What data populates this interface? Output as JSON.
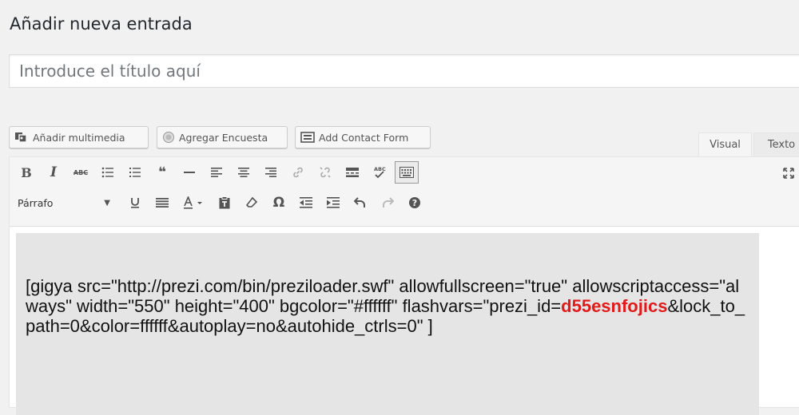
{
  "page": {
    "title": "Añadir nueva entrada"
  },
  "title_field": {
    "placeholder": "Introduce el título aquí",
    "value": ""
  },
  "media_buttons": [
    {
      "label": "Añadir multimedia",
      "icon": "media-icon"
    },
    {
      "label": "Agregar Encuesta",
      "icon": "poll-icon"
    },
    {
      "label": "Add Contact Form",
      "icon": "contact-form-icon"
    }
  ],
  "tabs": {
    "visual": "Visual",
    "text": "Texto",
    "active": "visual"
  },
  "toolbar": {
    "row1_icons": [
      "bold-icon",
      "italic-icon",
      "strikethrough-icon",
      "bullet-list-icon",
      "numbered-list-icon",
      "blockquote-icon",
      "horizontal-rule-icon",
      "align-left-icon",
      "align-center-icon",
      "align-right-icon",
      "link-icon",
      "unlink-icon",
      "read-more-icon",
      "spellcheck-icon",
      "toolbar-toggle-icon"
    ],
    "row2_icons": [
      "underline-icon",
      "justify-icon",
      "text-color-icon",
      "paste-text-icon",
      "clear-formatting-icon",
      "special-char-icon",
      "outdent-icon",
      "indent-icon",
      "undo-icon",
      "redo-icon",
      "help-icon"
    ],
    "format_select": {
      "selected": "Párrafo"
    },
    "italic_glyph": "I",
    "bold_glyph": "B",
    "abc_glyph": "ABC",
    "quote_glyph": "66",
    "omega_glyph": "Ω",
    "help_glyph": "?"
  },
  "content": {
    "before": "[gigya src=\"http://prezi.com/bin/preziloader.swf\" allowfullscreen=\"true\" allowscriptaccess=\"always\" width=\"550\" height=\"400\" bgcolor=\"#ffffff\" flashvars=\"prezi_id=",
    "highlight": "d55esnfojics",
    "after": "&lock_to_path=0&color=ffffff&autoplay=no&autohide_ctrls=0\" ]"
  },
  "colors": {
    "highlight": "#e21a1a",
    "content_bg": "#e5e5e5",
    "toolbar_bg": "#f5f5f5"
  }
}
